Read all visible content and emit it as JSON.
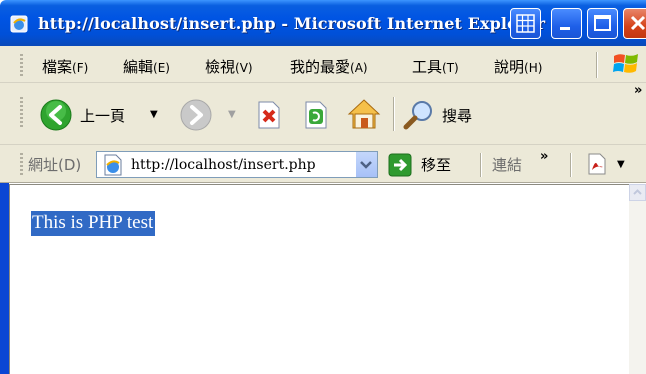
{
  "window": {
    "title": "http://localhost/insert.php - Microsoft Internet Explorer",
    "icon": "ie-page-icon",
    "controls": [
      "grid-icon",
      "minimize-icon",
      "maximize-icon",
      "close-icon"
    ]
  },
  "menubar": {
    "items": [
      {
        "label": "檔案",
        "accel": "(F)"
      },
      {
        "label": "編輯",
        "accel": "(E)"
      },
      {
        "label": "檢視",
        "accel": "(V)"
      },
      {
        "label": "我的最愛",
        "accel": "(A)"
      },
      {
        "label": "工具",
        "accel": "(T)"
      },
      {
        "label": "說明",
        "accel": "(H)"
      }
    ],
    "logo": "windows-logo"
  },
  "toolbar": {
    "back_label": "上一頁",
    "search_label": "搜尋",
    "overflow": "»",
    "icons": [
      "back-icon",
      "forward-icon",
      "stop-icon",
      "refresh-icon",
      "home-icon",
      "search-icon"
    ]
  },
  "addressbar": {
    "label": "網址(D)",
    "url": "http://localhost/insert.php",
    "go_label": "移至",
    "links_label": "連結",
    "overflow": "»"
  },
  "content": {
    "selected_text": "This is PHP test"
  },
  "colors": {
    "titlebar": "#0054e3",
    "chrome": "#ece9d8",
    "selection": "#316ac5"
  }
}
